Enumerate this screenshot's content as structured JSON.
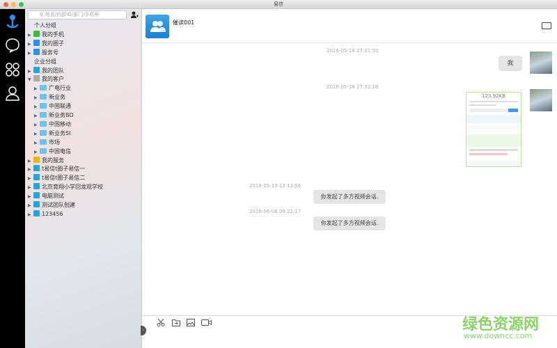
{
  "window": {
    "title": "易信"
  },
  "search": {
    "placeholder": "姓名/内部ID/部门/手机号"
  },
  "tree": [
    {
      "label": "个人分组",
      "type": "header"
    },
    {
      "label": "我的手机",
      "type": "group",
      "color": "#3dbb3d"
    },
    {
      "label": "我的圈子",
      "type": "group",
      "color": "#2e8fe0"
    },
    {
      "label": "服务号",
      "type": "group",
      "color": "#2e8fe0"
    },
    {
      "label": "企业分组",
      "type": "header"
    },
    {
      "label": "我的团队",
      "type": "group",
      "color": "#2aa3d8"
    },
    {
      "label": "我的客户",
      "type": "group-open",
      "color": "#aaaaaa"
    },
    {
      "label": "广电行业",
      "type": "folder"
    },
    {
      "label": "新业务",
      "type": "folder"
    },
    {
      "label": "中国联通",
      "type": "folder"
    },
    {
      "label": "新业务BD",
      "type": "folder"
    },
    {
      "label": "中国移动",
      "type": "folder"
    },
    {
      "label": "新业务SI",
      "type": "folder"
    },
    {
      "label": "市场",
      "type": "folder"
    },
    {
      "label": "中国电信",
      "type": "folder"
    },
    {
      "label": "我的服务",
      "type": "group",
      "color": "#f2b21b"
    },
    {
      "label": "t易信t圈子易信一",
      "type": "group",
      "color": "#2aa3d8"
    },
    {
      "label": "t易信t圈子易信二",
      "type": "group",
      "color": "#2aa3d8"
    },
    {
      "label": "北京育翔小学回龙观学校",
      "type": "group",
      "color": "#2aa3d8"
    },
    {
      "label": "电脑测试",
      "type": "group",
      "color": "#2aa3d8"
    },
    {
      "label": "测试团队创建",
      "type": "group",
      "color": "#2aa3d8"
    },
    {
      "label": "123456",
      "type": "group",
      "color": "#2aa3d8"
    }
  ],
  "chat": {
    "name": "催读001",
    "messages": [
      {
        "time": "2016-05-18 17:31:50",
        "text": "我"
      },
      {
        "time": "2016-05-18 17:32:18",
        "image_size": "123.92KB"
      },
      {
        "time": "2016-05-19 13:13:56",
        "text": "你发起了多方视频会话."
      },
      {
        "time": "2016-06-06 09:22:17",
        "text": "你发起了多方视频会话."
      }
    ]
  },
  "watermark": {
    "title": "绿色资源网",
    "url": "www.downcc.com"
  }
}
